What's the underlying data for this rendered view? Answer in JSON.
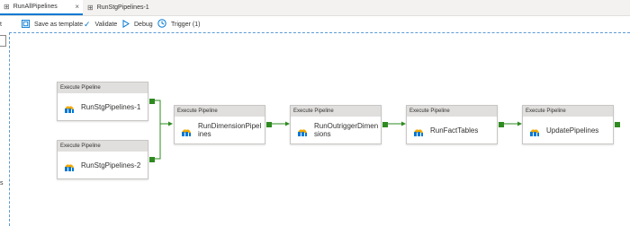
{
  "tabs": [
    {
      "label": "RunAllPipelines",
      "active": true,
      "close": "×"
    },
    {
      "label": "RunStgPipelines-1",
      "active": false
    }
  ],
  "toolbar": {
    "save_template": "Save as template",
    "validate": "Validate",
    "debug": "Debug",
    "trigger": "Trigger (1)"
  },
  "side_chars": [
    "t",
    "s"
  ],
  "nodes": [
    {
      "type": "Execute Pipeline",
      "name": "RunStgPipelines-1"
    },
    {
      "type": "Execute Pipeline",
      "name": "RunStgPipelines-2"
    },
    {
      "type": "Execute Pipeline",
      "name": "RunDimensionPipelines"
    },
    {
      "type": "Execute Pipeline",
      "name": "RunOutriggerDimensions"
    },
    {
      "type": "Execute Pipeline",
      "name": "RunFactTables"
    },
    {
      "type": "Execute Pipeline",
      "name": "UpdatePipelines"
    }
  ],
  "colors": {
    "accent": "#0078d4",
    "success_port": "#2e8b1f",
    "link": "#2e8b1f"
  }
}
